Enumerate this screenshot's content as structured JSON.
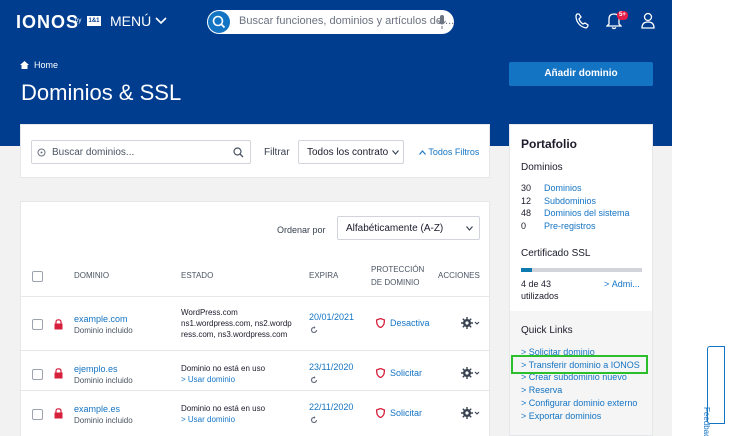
{
  "brand": {
    "logo": "IONOS",
    "logo_sub": "by",
    "logo_badge": "1&1"
  },
  "header": {
    "menu_label": "MENÚ",
    "search_placeholder": "Buscar funciones, dominios y artículos de ...",
    "notification_count": "5+"
  },
  "hero": {
    "breadcrumb": "Home",
    "title": "Dominios & SSL",
    "add_button": "Añadir dominio"
  },
  "filters": {
    "search_placeholder": "Buscar dominios...",
    "filter_label": "Filtrar",
    "contract_select": "Todos los contrato",
    "all_filters": "Todos Filtros"
  },
  "table": {
    "sort_label": "Ordenar por",
    "sort_value": "Alfabéticamente (A-Z)",
    "columns": {
      "domain": "DOMINIO",
      "status": "ESTADO",
      "expires": "EXPIRA",
      "protection_1": "PROTECCIÓN",
      "protection_2": "DE DOMINIO",
      "actions": "ACCIONES"
    },
    "rows": [
      {
        "domain": "example.com",
        "sub": "Dominio incluido",
        "status_1": "WordPress.com",
        "status_2": "ns1.wordpress.com, ns2.wordp",
        "status_3": "ress.com, ns3.wordpress.com",
        "status_link": "",
        "expires": "20/01/2021",
        "protection": "Desactiva"
      },
      {
        "domain": "ejemplo.es",
        "sub": "Dominio incluido",
        "status_1": "Dominio no está en uso",
        "status_2": "",
        "status_3": "",
        "status_link": "Usar dominio",
        "expires": "23/11/2020",
        "protection": "Solicitar"
      },
      {
        "domain": "example.es",
        "sub": "Dominio incluido",
        "status_1": "Dominio no está en uso",
        "status_2": "",
        "status_3": "",
        "status_link": "Usar dominio",
        "expires": "22/11/2020",
        "protection": "Solicitar"
      }
    ]
  },
  "portfolio": {
    "title": "Portafolio",
    "domains_heading": "Dominios",
    "counts": [
      {
        "num": "30",
        "label": "Dominios"
      },
      {
        "num": "12",
        "label": "Subdominios"
      },
      {
        "num": "48",
        "label": "Dominios del sistema"
      },
      {
        "num": "0",
        "label": "Pre-registros"
      }
    ],
    "ssl_heading": "Certificado SSL",
    "ssl_used": "4 de 43",
    "ssl_used_2": "utilizados",
    "ssl_fraction": 0.093,
    "ssl_link": "Admi...",
    "quick_links_heading": "Quick Links",
    "quick_links": [
      "Solicitar dominio",
      "Transferir dominio a IONOS",
      "Crear subdominio nuevo",
      "Reserva",
      "Configurar dominio externo",
      "Exportar dominios"
    ]
  },
  "feedback": "Feedback",
  "colors": {
    "brand_blue": "#003d8f",
    "link_blue": "#1474c4",
    "highlight_green": "#2bc02b",
    "alert_red": "#e11d48"
  }
}
